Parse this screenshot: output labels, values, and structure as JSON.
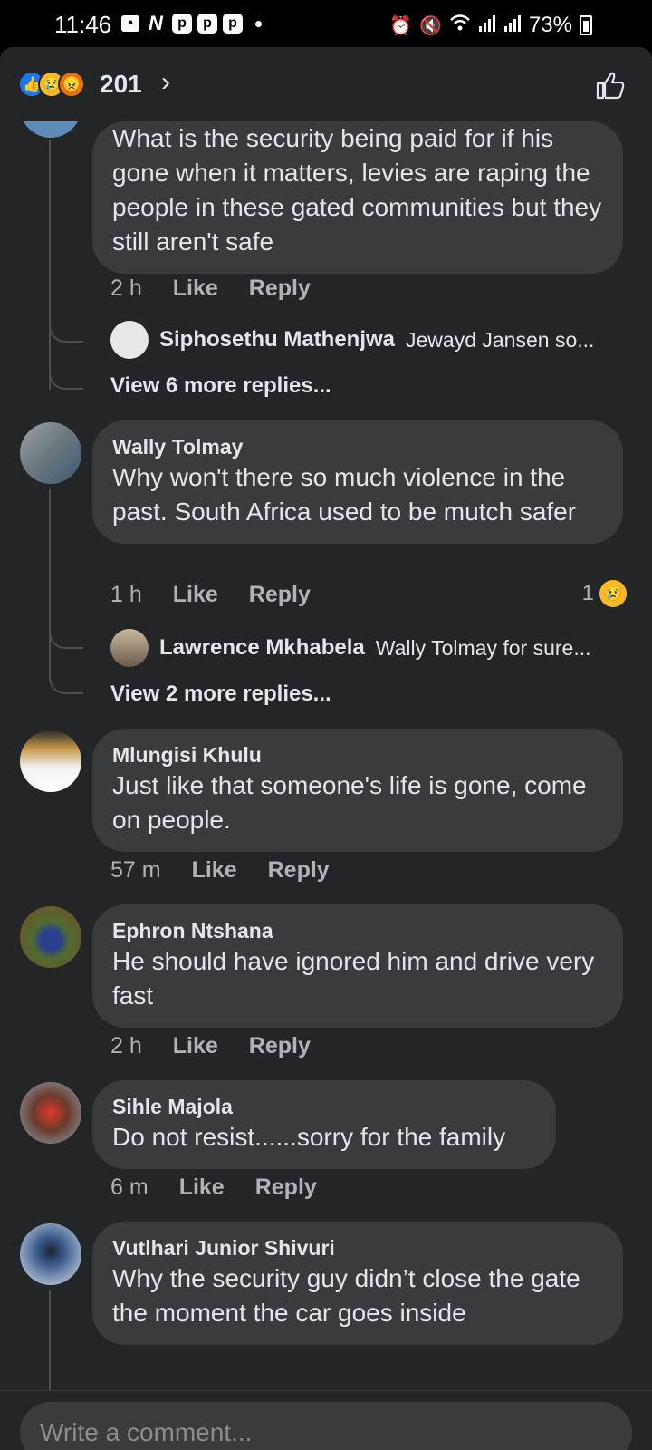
{
  "status_bar": {
    "time": "11:46",
    "battery": "73%",
    "notification_icons": [
      "message-icon",
      "netflix-icon",
      "p-app-icon",
      "p-app-icon",
      "p-app-icon"
    ],
    "status_icons": [
      "alarm-icon",
      "mute-icon",
      "wifi-icon",
      "signal-icon",
      "signal-icon",
      "battery-icon"
    ]
  },
  "header": {
    "reaction_count": "201",
    "reactions": [
      "like",
      "sad",
      "angry"
    ]
  },
  "comments": [
    {
      "author": "",
      "text": "What is the security being paid for if his gone when it matters, levies are raping the people in these gated communities but they still aren't safe",
      "time": "2 h",
      "like_label": "Like",
      "reply_label": "Reply",
      "reply_preview": {
        "name": "Siphosethu Mathenjwa",
        "text": "Jewayd Jansen so..."
      },
      "view_more": "View 6 more replies..."
    },
    {
      "author": "Wally Tolmay",
      "text": "Why won't there so much violence in the past. South Africa used to be mutch safer",
      "time": "1 h",
      "like_label": "Like",
      "reply_label": "Reply",
      "reaction_count": "1",
      "reply_preview": {
        "name": "Lawrence Mkhabela",
        "text": "Wally Tolmay for sure..."
      },
      "view_more": "View 2 more replies..."
    },
    {
      "author": "Mlungisi Khulu",
      "text": "Just like that someone's life is gone, come on people.",
      "time": "57 m",
      "like_label": "Like",
      "reply_label": "Reply"
    },
    {
      "author": "Ephron Ntshana",
      "text": "He should have ignored him and drive very fast",
      "time": "2 h",
      "like_label": "Like",
      "reply_label": "Reply"
    },
    {
      "author": "Sihle Majola",
      "text": "Do not resist......sorry for the family",
      "time": "6 m",
      "like_label": "Like",
      "reply_label": "Reply"
    },
    {
      "author": "Vutlhari Junior Shivuri",
      "text": "Why the security guy didn’t close the gate the moment the car goes inside"
    }
  ],
  "composer": {
    "placeholder": "Write a comment..."
  },
  "colors": {
    "background": "#242526",
    "bubble": "#3a3b3c",
    "text": "#e4e6eb",
    "muted": "#b0b3b8",
    "like_blue": "#1877f2",
    "sad_yellow": "#f7b928",
    "angry_orange": "#e9710f"
  }
}
